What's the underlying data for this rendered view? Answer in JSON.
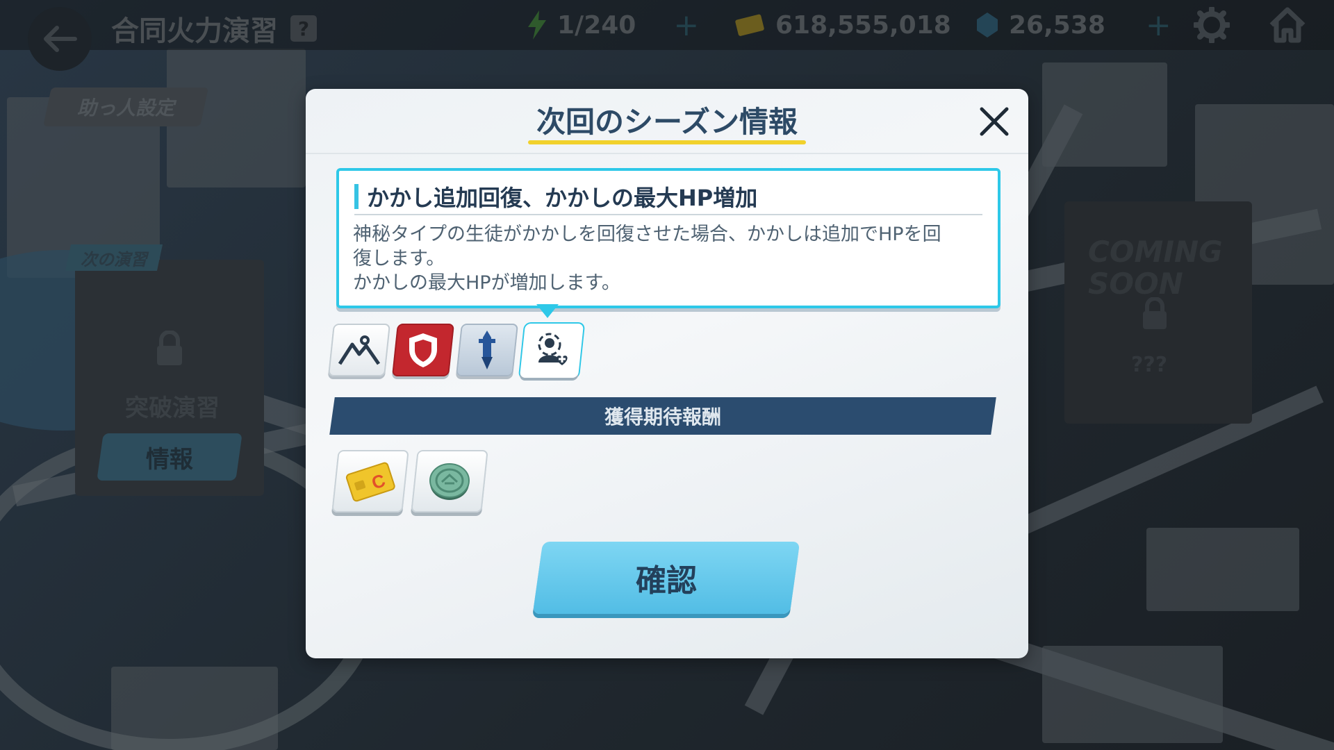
{
  "header": {
    "title": "合同火力演習",
    "help": "?",
    "stamina": "1/240",
    "credits": "618,555,018",
    "gems": "26,538"
  },
  "left_panel": {
    "helper_settings": "助っ人設定",
    "next_exercise": "次の演習",
    "breakthrough": "突破演習",
    "info_button": "情報"
  },
  "right_panel": {
    "coming_soon": "COMING SOON",
    "unknown": "???"
  },
  "modal": {
    "title": "次回のシーズン情報",
    "description": {
      "title": "かかし追加回復、かかしの最大HP増加",
      "line1": "神秘タイプの生徒がかかしを回復させた場合、かかしは追加でHPを回",
      "line2": "復します。",
      "line3": "かかしの最大HPが増加します。"
    },
    "buffs": [
      {
        "icon": "terrain-icon"
      },
      {
        "icon": "defense-shield-icon",
        "color": "#c3272e"
      },
      {
        "icon": "attack-sword-icon"
      },
      {
        "icon": "heal-target-icon",
        "selected": true
      }
    ],
    "reward_header": "獲得期待報酬",
    "rewards": [
      {
        "icon": "credit-card-icon"
      },
      {
        "icon": "coin-icon"
      }
    ],
    "confirm_button": "確認"
  },
  "colors": {
    "accent_cyan": "#2ec8e8",
    "title_underline": "#f1d12c",
    "reward_bar": "#2b4c6f",
    "confirm_button": "#52bde5"
  }
}
